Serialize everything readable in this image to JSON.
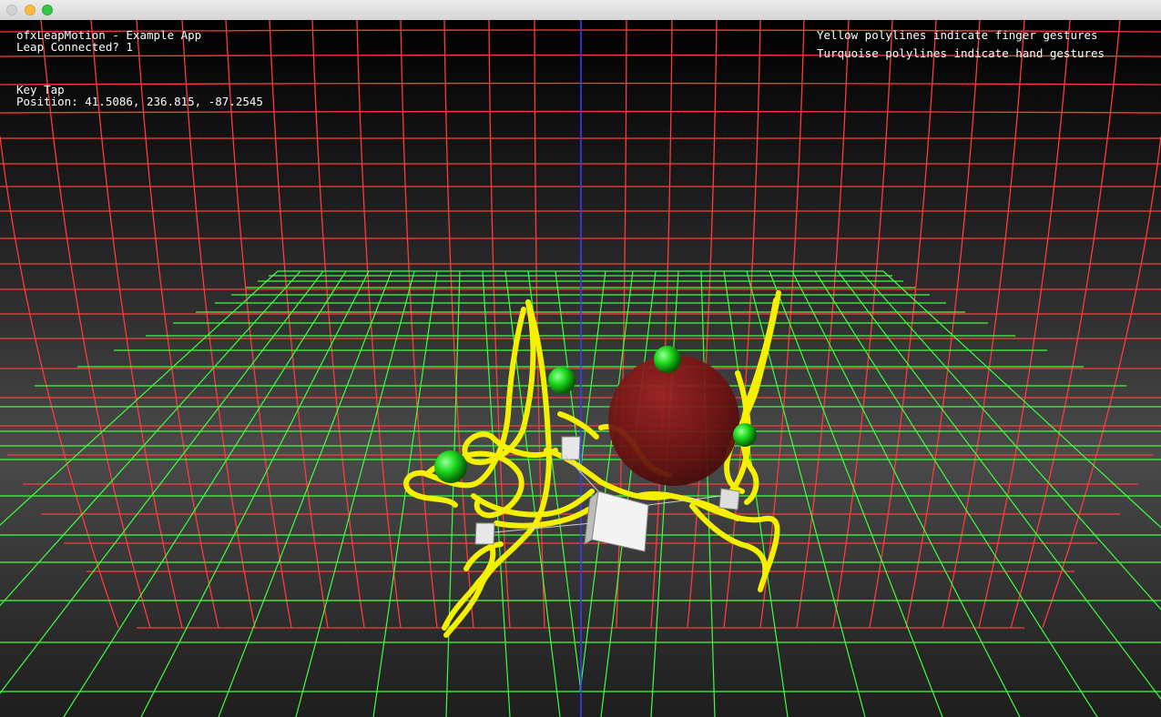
{
  "window": {
    "buttons": [
      "close",
      "minimize",
      "maximize"
    ]
  },
  "hud": {
    "app_title": "ofxLeapMotion - Example App",
    "leap_connected": "Leap Connected? 1",
    "gesture_name": "Key Tap",
    "gesture_position": "Position: 41.5086, 236.815, -87.2545",
    "legend_finger": "Yellow polylines indicate finger gestures",
    "legend_hand": "Turquoise polylines indicate hand gestures"
  },
  "colors": {
    "wall_grid": "#ff3b3b",
    "floor_grid": "#3dff3d",
    "axis_line": "#3b3bff",
    "finger_trails": "#f5f000",
    "fingertips": "#22dd22",
    "palm": "#7a1010"
  }
}
